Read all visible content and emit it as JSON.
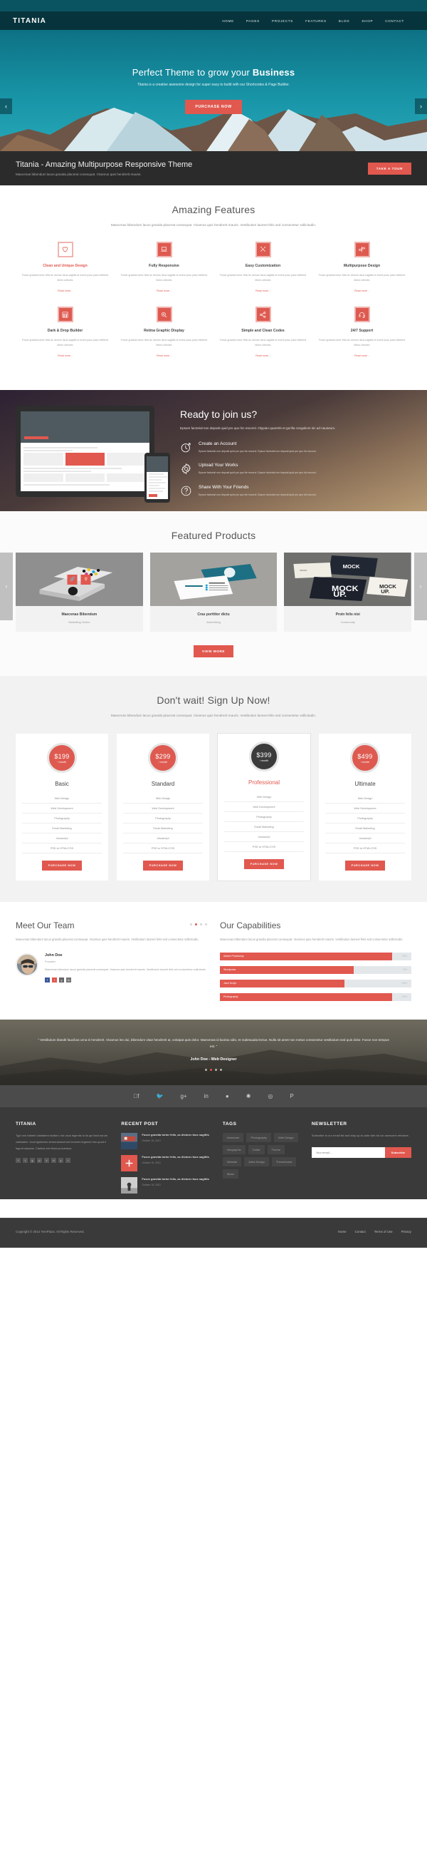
{
  "header": {
    "logo": "TITANIA",
    "nav": [
      "HOME",
      "PAGES",
      "PROJECTS",
      "FEATURES",
      "BLOG",
      "SHOP",
      "CONTACT"
    ]
  },
  "hero": {
    "title_plain": "Perfect Theme to grow your ",
    "title_bold": "Business",
    "subtitle": "Titania is a creative awesome design for super easy to build with our Shortcodes & Page Builder.",
    "cta": "PURCHASE NOW",
    "prev": "‹",
    "next": "›"
  },
  "banner": {
    "title": "Titania - Amazing Multipurpose Responsive Theme",
    "subtitle": "Maecenas bibendum lacus gravida placerat consequat. Vivamus quis hendrerit mauris.",
    "cta": "TAKE A TOUR"
  },
  "features": {
    "title": "Amazing Features",
    "description": "Maecenas bibendum lacus gravida placerat consequat. Vivamus quis hendrerit mauris. Vestibulum laoreet felis sed consectetur sollicitudin.",
    "read_more": "Read more...",
    "body": "Fusce gravida tortor felis Ac dictum risus sagittis id morbi posu justo eleifend libero ultricies",
    "items": [
      {
        "title": "Clean and Unique Design",
        "icon": "heart-icon",
        "style": "outline"
      },
      {
        "title": "Fully Responsive",
        "icon": "laptop-icon",
        "style": "solid"
      },
      {
        "title": "Easy Customization",
        "icon": "tools-icon",
        "style": "solid"
      },
      {
        "title": "Multipurpose Design",
        "icon": "signpost-icon",
        "style": "solid"
      },
      {
        "title": "Dark & Drop Builder",
        "icon": "grid-icon",
        "style": "solid"
      },
      {
        "title": "Retina Graphic Display",
        "icon": "zoom-in-icon",
        "style": "solid"
      },
      {
        "title": "Simple and Clean Codes",
        "icon": "share-icon",
        "style": "solid"
      },
      {
        "title": "24/7 Support",
        "icon": "headset-icon",
        "style": "solid"
      }
    ]
  },
  "join": {
    "title": "Ready to join us?",
    "description": "Epsum factorial non deposit quid pro quo hic escorol. Olypian quarrels et gorilla congolium sic ad nauseum.",
    "item_body": "Epsum factorial non deposit quid pro quo hic escorol. Epsum factorial non deposit quid pro quo hic escorol.",
    "items": [
      {
        "title": "Create an Account",
        "icon": "clock-icon"
      },
      {
        "title": "Upload Your Works",
        "icon": "gear-icon"
      },
      {
        "title": "Share With Your Friends",
        "icon": "question-icon"
      }
    ]
  },
  "products": {
    "title": "Featured Products",
    "view_more": "VIEW MORE",
    "prev": "‹",
    "next": "›",
    "items": [
      {
        "title": "Maecenas Bibendum",
        "category": "Marketing Online"
      },
      {
        "title": "Cras porttitor dictu",
        "category": "Advertising"
      },
      {
        "title": "Proin felis nisi",
        "category": "Community"
      }
    ]
  },
  "pricing": {
    "title": "Don't wait! Sign Up Now!",
    "description": "Maecenas bibendum lacus gravida placerat consequat. Vivamus quis hendrerit mauris. Vestibulum laoreet felis sed consectetur sollicitudin.",
    "per": "/ month",
    "cta": "PURCHASE NOW",
    "features": [
      "Web Design",
      "Web Development",
      "Photography",
      "Email Marketing",
      "Javascript",
      "PSD to HTML/CSS"
    ],
    "plans": [
      {
        "price": "$199",
        "name": "Basic",
        "featured": false
      },
      {
        "price": "$299",
        "name": "Standard",
        "featured": false
      },
      {
        "price": "$399",
        "name": "Professional",
        "featured": true
      },
      {
        "price": "$499",
        "name": "Ultimate",
        "featured": false
      }
    ]
  },
  "team": {
    "title": "Meet Our Team",
    "description": "Maecenas bibendum lacus gravida placerat consequat. Vivamus quis hendrerit mauris. Vestibulum laoreet felis sed consectetur sollicitudin.",
    "member": {
      "name": "John Doe",
      "role": "Founder",
      "bio": "Maecenas bibendum lacus gravida placerat consequat. Vivamus quis hendrerit mauris. Vestibulum laoreet felis sed consectetur sollicitudin."
    },
    "socials": [
      "f",
      "t",
      "g",
      "in"
    ]
  },
  "capabilities": {
    "title": "Our Capabilities",
    "description": "Maecenas bibendum lacus gravida placerat consequat. Vivamus quis hendrerit mauris. Vestibulum laoreet felis sed consectetur sollicitudin.",
    "bars": [
      {
        "label": "Adobe Photoshop",
        "value": 90,
        "value_label": "90%"
      },
      {
        "label": "Wordpress",
        "value": 70,
        "value_label": "70%"
      },
      {
        "label": "Java Script",
        "value": 65,
        "value_label": "65%"
      },
      {
        "label": "Photography",
        "value": 90,
        "value_label": "90%"
      }
    ]
  },
  "testimonial": {
    "quote": "“ Vestibulum blandit faucibus urna in hendrerit. Vivamus leo dui, bibendum vitae hendrerit at, volutpat quis dolor. Maecenas id lacinia odio, et malesuada lectus. Nulla sit amet non metus consectetur vestibulum sed quis dolor. Fusce non tempus est. ”",
    "author": "John Doe - Web Designer",
    "dots": 4,
    "active_dot": 1
  },
  "social_strip": [
    "facebook-icon",
    "twitter-icon",
    "google-plus-icon",
    "linkedin-icon",
    "dribbble-icon",
    "flickr-icon",
    "rss-icon",
    "pinterest-icon"
  ],
  "footer": {
    "about": {
      "title": "TITANIA",
      "text": "Typi non habent claritatem insitam; est usus legentis in iis qui facit eorum claritatem. Invst igationes demonstraverunt lectores legemer lius quod ii legunt saepius. Claritas est etiam processus.",
      "socials": [
        "f",
        "t",
        "g",
        "p",
        "v",
        "d",
        "y",
        "r"
      ]
    },
    "recent": {
      "title": "RECENT POST",
      "posts": [
        {
          "title": "Fusce gravida tortor felis, ac dictum risus sagittis",
          "date": "October 15, 2013"
        },
        {
          "title": "Fusce gravida tortor felis, ac dictum risus sagittis",
          "date": "October 15, 2013"
        },
        {
          "title": "Fusce gravida tortor felis, ac dictum risus sagittis",
          "date": "October 15, 2013"
        }
      ]
    },
    "tags": {
      "title": "TAGS",
      "items": [
        "Awesome",
        "Photography",
        "Web Design",
        "Infographic",
        "Guitar",
        "Theme",
        "Website",
        "Artist Design",
        "Themeforest",
        "Music"
      ]
    },
    "newsletter": {
      "title": "NEWSLETTER",
      "text": "Subscribe to our email list and stay up-to-date with all our awesome releases",
      "placeholder": "Your email...",
      "button": "Subscribe"
    },
    "copyright": "Copyright © 2014 TemPlaza. All Rights Reserved.",
    "links": [
      "Home",
      "Contact",
      "Terms of Use",
      "Privacy"
    ]
  },
  "colors": {
    "accent": "#e1584f",
    "teal": "#0e7184",
    "dark": "#2b2b2b",
    "footer": "#3a3a3a"
  }
}
